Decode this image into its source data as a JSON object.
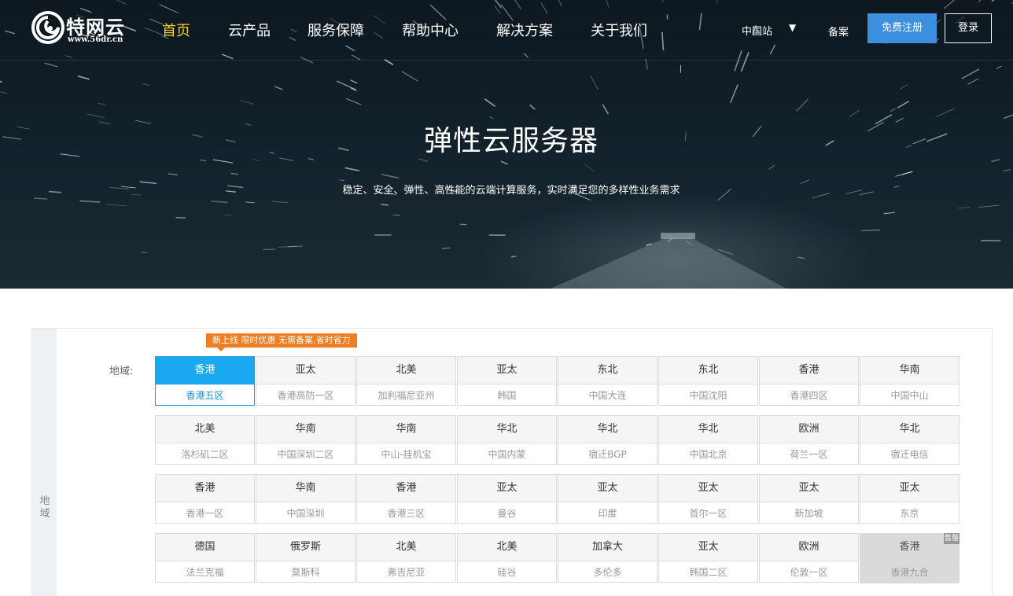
{
  "header": {
    "logo_name": "特网云",
    "logo_url": "www.56dr.cn",
    "nav": [
      "首页",
      "云产品",
      "服务保障",
      "帮助中心",
      "解决方案",
      "关于我们"
    ],
    "station": "中国站",
    "caret": "▼",
    "beian": "备案",
    "register": "免费注册",
    "login": "登录"
  },
  "hero": {
    "title": "弹性云服务器",
    "subtitle": "稳定、安全、弹性、高性能的云端计算服务，实时满足您的多样性业务需求"
  },
  "region_panel": {
    "side_label": "地域",
    "promo": "新上线 限时优惠 无需备案,省时省力",
    "label": "地域:",
    "rows": [
      [
        {
          "area": "香港",
          "zone": "香港五区",
          "state": "selected"
        },
        {
          "area": "亚太",
          "zone": "香港高防一区"
        },
        {
          "area": "北美",
          "zone": "加利福尼亚州"
        },
        {
          "area": "亚太",
          "zone": "韩国"
        },
        {
          "area": "东北",
          "zone": "中国大连"
        },
        {
          "area": "东北",
          "zone": "中国沈阳"
        },
        {
          "area": "香港",
          "zone": "香港四区"
        },
        {
          "area": "华南",
          "zone": "中国中山"
        }
      ],
      [
        {
          "area": "北美",
          "zone": "洛杉矶二区"
        },
        {
          "area": "华南",
          "zone": "中国深圳二区"
        },
        {
          "area": "华南",
          "zone": "中山-挂机宝"
        },
        {
          "area": "华北",
          "zone": "中国内蒙"
        },
        {
          "area": "华北",
          "zone": "宿迁BGP"
        },
        {
          "area": "华北",
          "zone": "中国北京"
        },
        {
          "area": "欧洲",
          "zone": "荷兰一区"
        },
        {
          "area": "华北",
          "zone": "宿迁电信"
        }
      ],
      [
        {
          "area": "香港",
          "zone": "香港一区"
        },
        {
          "area": "华南",
          "zone": "中国深圳"
        },
        {
          "area": "香港",
          "zone": "香港三区"
        },
        {
          "area": "亚太",
          "zone": "曼谷"
        },
        {
          "area": "亚太",
          "zone": "印度"
        },
        {
          "area": "亚太",
          "zone": "首尔一区"
        },
        {
          "area": "亚太",
          "zone": "新加坡"
        },
        {
          "area": "亚太",
          "zone": "东京"
        }
      ],
      [
        {
          "area": "德国",
          "zone": "法兰克福"
        },
        {
          "area": "俄罗斯",
          "zone": "莫斯科"
        },
        {
          "area": "北美",
          "zone": "弗吉尼亚"
        },
        {
          "area": "北美",
          "zone": "硅谷"
        },
        {
          "area": "加拿大",
          "zone": "多伦多"
        },
        {
          "area": "亚太",
          "zone": "韩国二区"
        },
        {
          "area": "欧洲",
          "zone": "伦敦一区"
        },
        {
          "area": "香港",
          "zone": "香港九合",
          "state": "disabled",
          "badge": "售罄"
        }
      ]
    ]
  },
  "colors": {
    "nav_active": "#f5d42a",
    "register_bg": "#3d8fe0",
    "selected": "#1aa8f0",
    "promo": "#f07d1f"
  }
}
